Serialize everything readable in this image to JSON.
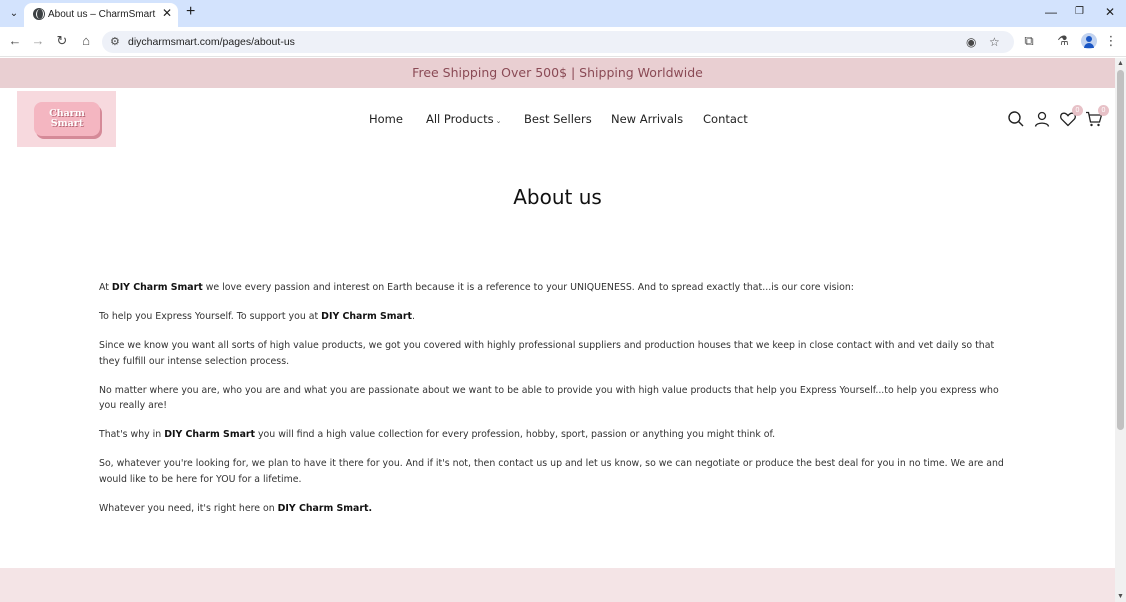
{
  "browser": {
    "tab_title": "About us – CharmSmart",
    "new_tab": "+",
    "url": "diycharmsmart.com/pages/about-us",
    "icons": [
      "tab-list-icon",
      "close-icon",
      "back-icon",
      "forward-icon",
      "reload-icon",
      "home-icon",
      "site-info-icon",
      "eye-off-icon",
      "star-icon",
      "extensions-icon",
      "lab-icon",
      "profile-icon",
      "menu-icon",
      "minimize-icon",
      "restore-icon",
      "window-close-icon"
    ]
  },
  "announcement": "Free Shipping Over 500$ | Shipping Worldwide",
  "logo": {
    "text": "Charm\nSmart"
  },
  "nav": {
    "home": "Home",
    "all_products": "All Products",
    "best_sellers": "Best Sellers",
    "new_arrivals": "New Arrivals",
    "contact": "Contact"
  },
  "header": {
    "wishlist_count": "0",
    "cart_count": "0"
  },
  "page": {
    "title": "About us",
    "p1": {
      "a": "At ",
      "brand": "DIY Charm Smart",
      "b": " we love every passion and interest on Earth because it is a reference to your UNIQUENESS. And to spread exactly that...is our core vision:"
    },
    "p2": {
      "a": "To help you Express Yourself. To support you at ",
      "brand": "DIY Charm Smart",
      "b": "."
    },
    "p3": "Since we know you want all sorts of high value products, we got you covered with highly professional suppliers and production houses that we keep in close contact with and vet daily so that they fulfill our intense selection process.",
    "p4": "No matter where you are, who you are and what you are passionate about we want to be able to provide you with high value products that help you Express Yourself...to help you express who you really are!",
    "p5": {
      "a": "That's why in ",
      "brand": "DIY Charm Smart",
      "b": " you will find a high value collection for every profession, hobby, sport, passion or anything you might think of."
    },
    "p6": "So, whatever you're looking for, we plan to have it there for you. And if it's not, then contact us up and let us know, so we can negotiate or produce the best deal for you in no time. We are and would like to be here for YOU for a lifetime.",
    "p7": {
      "a": "Whatever you need, it's right here on ",
      "brand": "DIY Charm Smart."
    }
  },
  "colors": {
    "announcement_bg": "#e9cfd2",
    "announcement_text": "#8a4a55",
    "footer_bg": "#f4e4e6",
    "chrome_tabstrip": "#d3e3fd"
  }
}
